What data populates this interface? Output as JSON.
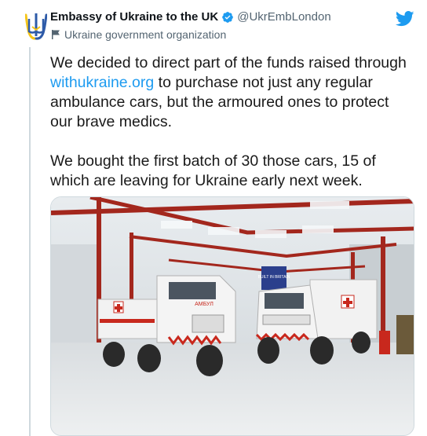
{
  "tweet": {
    "display_name": "Embassy of Ukraine to the UK",
    "handle": "@UkrEmbLondon",
    "affiliation": "Ukraine government organization",
    "text_p1_before": "We decided to direct part of the funds raised through ",
    "text_p1_link": "withukraine.org",
    "text_p1_after": " to purchase not just any regular ambulance cars, but the armoured ones to protect our brave medics.",
    "text_p2": "We bought the first batch of 30 those cars, 15 of which are leaving for Ukraine early next week.",
    "vehicle_marking": "АМБУЛ",
    "banner_text": "BUILT IN BRITAIN"
  },
  "icons": {
    "avatar": "ukraine-trident-icon",
    "verified": "verified-badge-icon",
    "affiliation": "flag-icon",
    "brand": "twitter-bird-icon"
  },
  "colors": {
    "link": "#1d9bf0",
    "verified": "#1d9bf0",
    "twitter_blue": "#1d9bf0",
    "trident_blue": "#2e5ba8",
    "trident_yellow": "#f5c518"
  }
}
